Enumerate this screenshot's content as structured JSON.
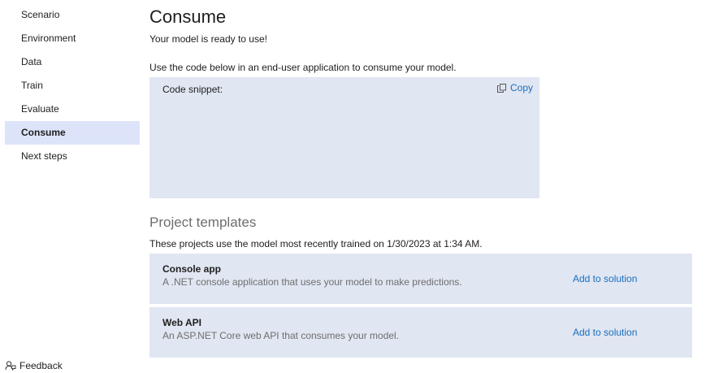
{
  "sidebar": {
    "items": [
      {
        "label": "Scenario"
      },
      {
        "label": "Environment"
      },
      {
        "label": "Data"
      },
      {
        "label": "Train"
      },
      {
        "label": "Evaluate"
      },
      {
        "label": "Consume",
        "active": true
      },
      {
        "label": "Next steps"
      }
    ],
    "feedback_label": "Feedback"
  },
  "main": {
    "title": "Consume",
    "subtitle": "Your model is ready to use!",
    "instructions": "Use the code below in an end-user application to consume your model.",
    "snippet": {
      "label": "Code snippet:",
      "copy_label": "Copy"
    },
    "templates": {
      "title": "Project templates",
      "description": "These projects use the model most recently trained on 1/30/2023 at 1:34 AM.",
      "items": [
        {
          "name": "Console app",
          "description": "A .NET console application that uses your model to make predictions.",
          "action": "Add to solution"
        },
        {
          "name": "Web API",
          "description": "An ASP.NET Core web API that consumes your model.",
          "action": "Add to solution"
        }
      ]
    }
  },
  "colors": {
    "active_nav_bg": "#dde4fa",
    "panel_bg": "#e0e6f2",
    "link": "#1a6ebd",
    "muted_text": "#6e6e6e"
  },
  "icons": {
    "copy": "copy-icon",
    "feedback": "feedback-icon"
  }
}
